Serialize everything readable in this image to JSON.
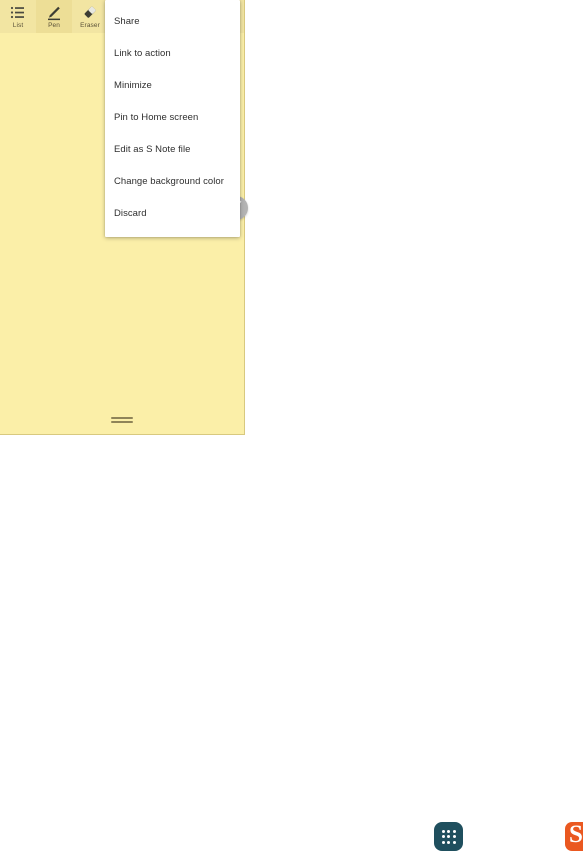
{
  "note_window": {
    "background_color": "#FBEFA8",
    "toolbar": {
      "background_color": "#F2E5A2",
      "tools": [
        {
          "id": "list",
          "label": "List",
          "icon": "list-icon",
          "selected": false
        },
        {
          "id": "pen",
          "label": "Pen",
          "icon": "pen-icon",
          "selected": true
        },
        {
          "id": "eraser",
          "label": "Eraser",
          "icon": "eraser-icon",
          "selected": false
        }
      ]
    },
    "resize_handle": {
      "icon": "drag-handle-icon"
    },
    "pen_fab": {
      "icon": "pen-icon",
      "color": "#b3b3b3"
    }
  },
  "overflow_menu": {
    "background_color": "#ffffff",
    "items": [
      {
        "label": "Share"
      },
      {
        "label": "Link to action"
      },
      {
        "label": "Minimize"
      },
      {
        "label": "Pin to Home screen"
      },
      {
        "label": "Edit as S Note file"
      },
      {
        "label": "Change background color"
      },
      {
        "label": "Discard"
      }
    ]
  },
  "taskbar": {
    "apps_button": {
      "icon": "apps-grid-icon",
      "color": "#1f4f5e"
    },
    "s_app_button": {
      "icon": "s-note-icon",
      "label": "S",
      "color": "#EA5820"
    }
  }
}
